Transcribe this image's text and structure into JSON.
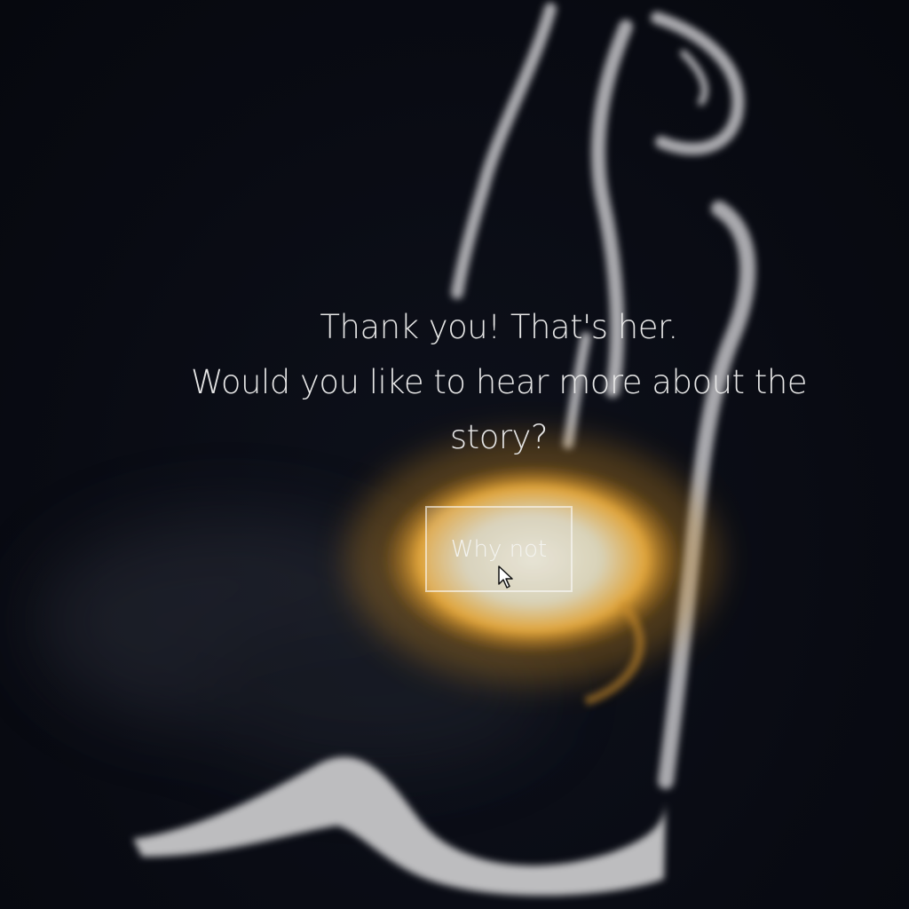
{
  "dialog": {
    "line_1": "Thank you! That's her.",
    "line_2": "Would you like to hear more about the",
    "line_3": "story?",
    "button_label": "Why not"
  },
  "colors": {
    "background": "#0a0d16",
    "stroke": "#b8b8b8",
    "glow": "#d99a2b",
    "text": "#e6e6e6"
  },
  "icons": {
    "cursor": "mouse-pointer-icon"
  }
}
